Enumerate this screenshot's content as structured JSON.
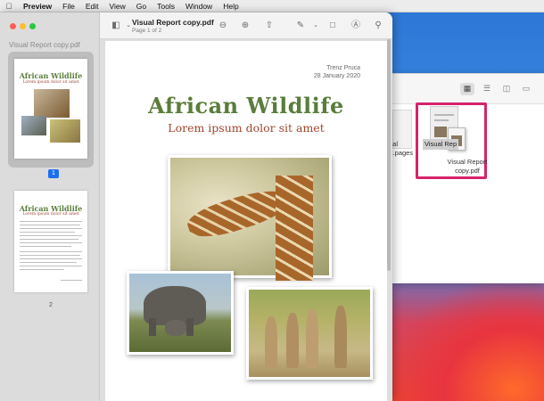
{
  "menubar": {
    "items": [
      "Preview",
      "File",
      "Edit",
      "View",
      "Go",
      "Tools",
      "Window",
      "Help"
    ]
  },
  "preview": {
    "sidebar_title": "Visual Report copy.pdf",
    "pages": [
      "1",
      "2"
    ],
    "thumb_title": "African Wildlife",
    "thumb_sub": "Lorem ipsum dolor sit amet",
    "doc_title": "Visual Report copy.pdf",
    "doc_subtitle": "Page 1 of 2"
  },
  "document": {
    "author": "Trenz Pruca",
    "date": "28 January 2020",
    "title": "African Wildlife",
    "subtitle": "Lorem ipsum dolor sit amet"
  },
  "finder": {
    "pages_file_label_1": "ual",
    "pages_file_label_2": "rt.pages",
    "drag_label": "Visual Rep",
    "file_caption_1": "Visual Report",
    "file_caption_2": "copy.pdf"
  },
  "colors": {
    "title_green": "#5a7d3b",
    "subtitle_red": "#a0472f",
    "selection_blue": "#1b6ff0",
    "highlight_pink": "#d6236b"
  }
}
